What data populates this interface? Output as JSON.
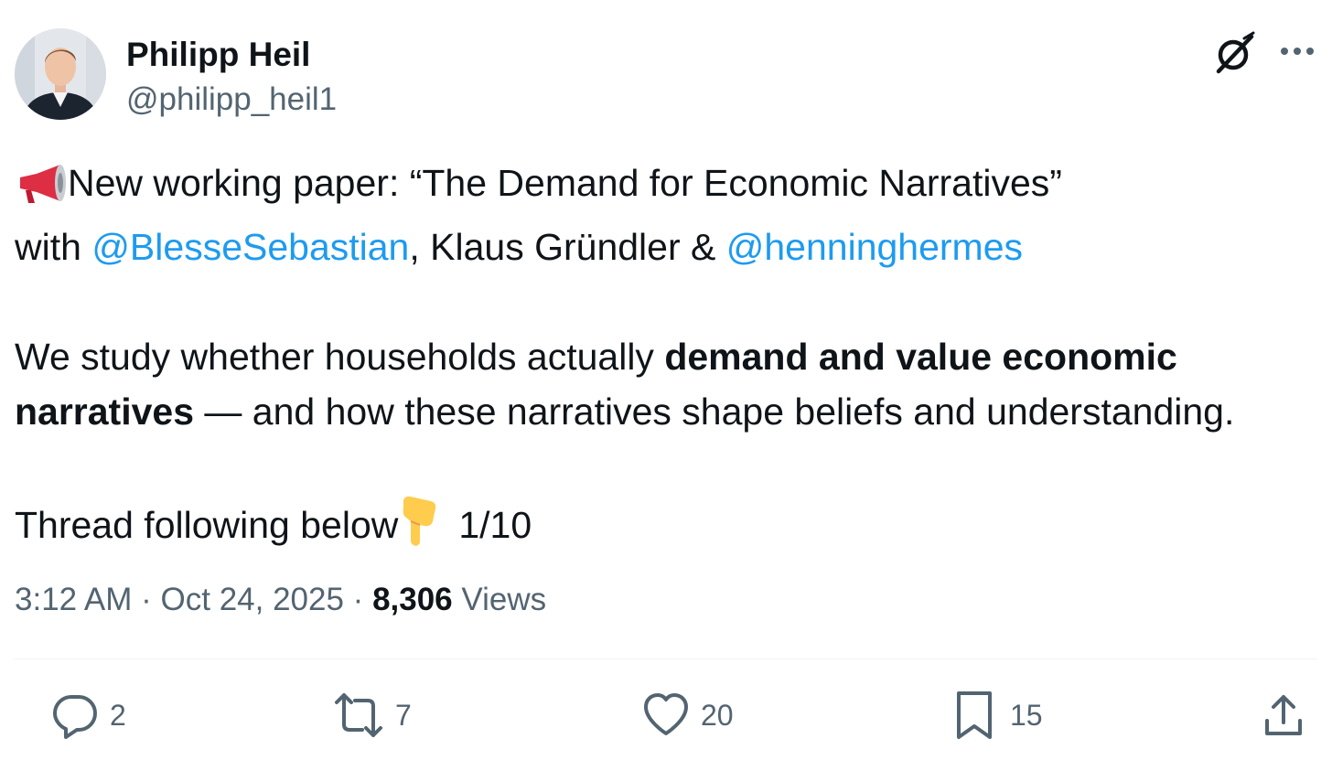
{
  "author": {
    "name": "Philipp Heil",
    "handle": "@philipp_heil1",
    "avatar_icon": "profile-photo"
  },
  "header_icons": {
    "grok": "grok-icon",
    "more": "more-icon"
  },
  "tweet": {
    "line1_text": "New working paper: “The Demand for Economic Narratives”",
    "line1_emoji": "megaphone-icon",
    "line2_prefix": "with ",
    "mention1": "@BlesseSebastian",
    "line2_middle": ", Klaus Gründler & ",
    "mention2": "@henninghermes",
    "para2_text1": "We study whether households actually ",
    "para2_bold1": "demand and value economic",
    "para2_bold2": "narratives",
    "para2_text2": " — and how these narratives shape beliefs and understanding.",
    "thread_text": "Thread following below",
    "thread_emoji": "pointing-down-icon",
    "thread_count": "1/10"
  },
  "meta": {
    "time": "3:12 AM",
    "separator": " · ",
    "date": "Oct 24, 2025",
    "views_count": "8,306",
    "views_label": " Views"
  },
  "actions": {
    "replies": "2",
    "reposts": "7",
    "likes": "20",
    "bookmarks": "15"
  },
  "colors": {
    "text": "#0f1419",
    "secondary": "#536471",
    "link": "#1d9bf0",
    "divider": "#eff3f4"
  }
}
